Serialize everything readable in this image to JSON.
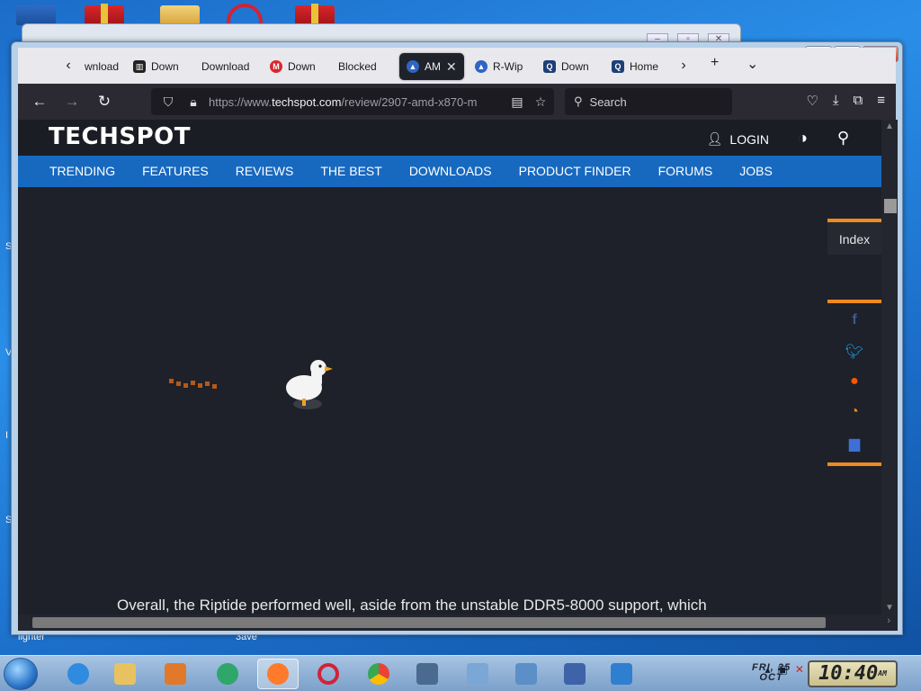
{
  "desktop": {
    "edge_labels": [
      "S",
      "V",
      "I",
      "S",
      "iighter",
      "3ave"
    ]
  },
  "browser": {
    "tabs": [
      {
        "label": "wnload",
        "favicon": "none"
      },
      {
        "label": "Down",
        "favicon": "archive-icon"
      },
      {
        "label": "Download",
        "favicon": "none"
      },
      {
        "label": "Down",
        "favicon": "mega-icon"
      },
      {
        "label": "Blocked",
        "favicon": "none"
      },
      {
        "label": "AM",
        "favicon": "triangle-icon",
        "active": true
      },
      {
        "label": "R-Wip",
        "favicon": "triangle-icon"
      },
      {
        "label": "Down",
        "favicon": "q-icon"
      },
      {
        "label": "Home",
        "favicon": "q-icon"
      }
    ],
    "url_prefix": "https://www.",
    "url_domain": "techspot.com",
    "url_path": "/review/2907-amd-x870-m",
    "search_placeholder": "Search"
  },
  "site": {
    "logo": "TECHSPOT",
    "login": "LOGIN",
    "menu": [
      "TRENDING",
      "FEATURES",
      "REVIEWS",
      "THE BEST",
      "DOWNLOADS",
      "PRODUCT FINDER",
      "FORUMS",
      "JOBS"
    ],
    "index_label": "Index",
    "share_icons": [
      "facebook-icon",
      "twitter-icon",
      "reddit-icon",
      "rss-icon",
      "comments-icon"
    ],
    "article_text": "Overall, the Riptide performed well, aside from the unstable DDR5-8000 support, which"
  },
  "taskbar": {
    "date_line1": "FRI, 25",
    "date_line2": "OCT",
    "time": "10:40",
    "ampm": "AM"
  },
  "colors": {
    "accent_orange": "#f08a1e",
    "menu_blue": "#1769c0",
    "page_bg": "#1e2129"
  }
}
